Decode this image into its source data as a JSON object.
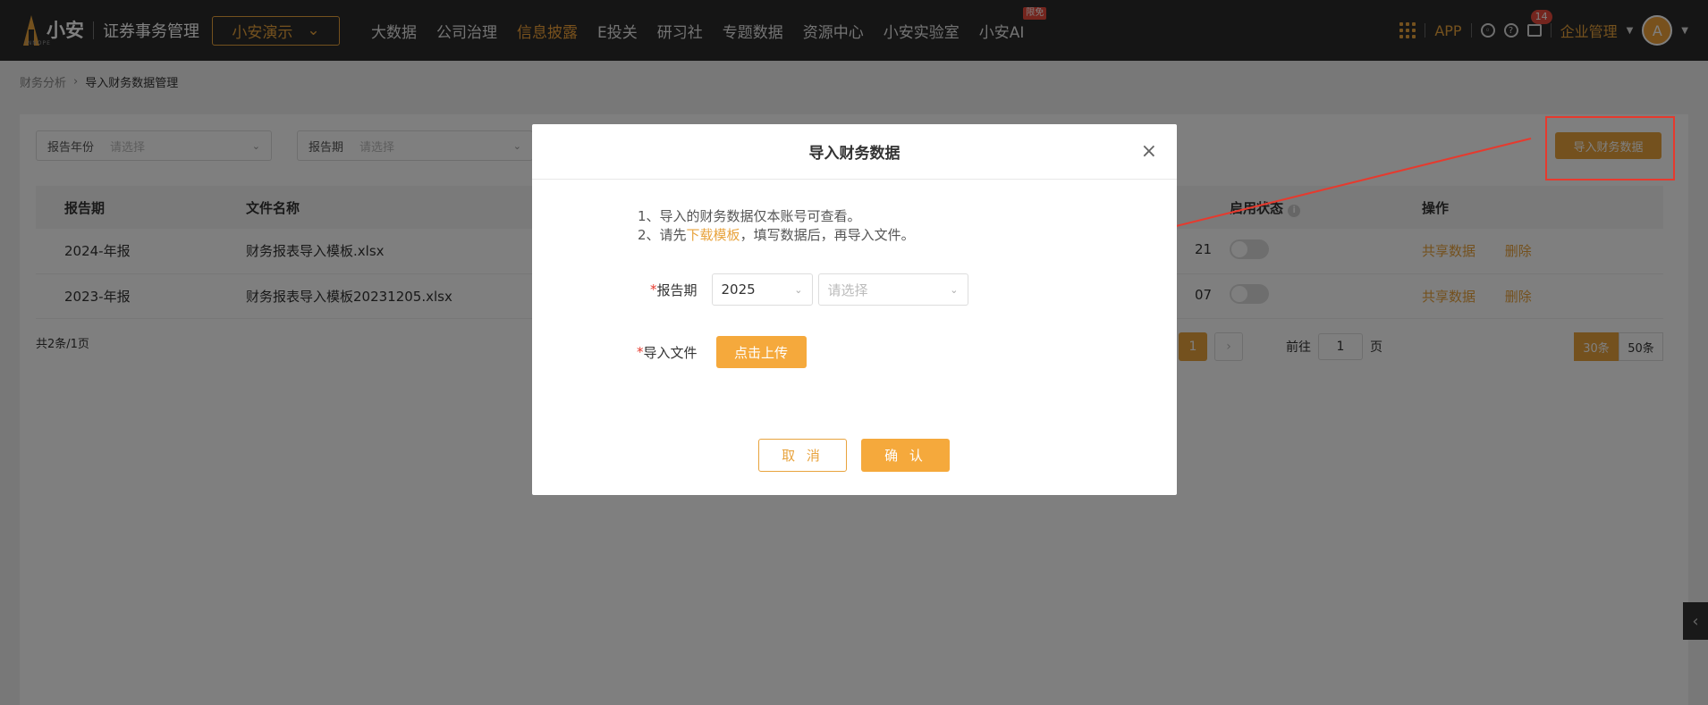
{
  "header": {
    "logo_text": "小安",
    "logo_sub": "INNOPE",
    "app_title": "证券事务管理",
    "company": "小安演示",
    "nav": [
      {
        "label": "大数据"
      },
      {
        "label": "公司治理"
      },
      {
        "label": "信息披露"
      },
      {
        "label": "E投关"
      },
      {
        "label": "研习社"
      },
      {
        "label": "专题数据"
      },
      {
        "label": "资源中心"
      },
      {
        "label": "小安实验室"
      },
      {
        "label": "小安AI"
      }
    ],
    "nav_badge": "限免",
    "app_label": "APP",
    "message_count": "14",
    "enterprise_menu": "企业管理",
    "avatar_letter": "A"
  },
  "breadcrumb": {
    "parent": "财务分析",
    "current": "导入财务数据管理"
  },
  "filters": {
    "year_label": "报告年份",
    "year_placeholder": "请选择",
    "period_label": "报告期",
    "period_placeholder": "请选择"
  },
  "import_button": "导入财务数据",
  "table": {
    "headers": [
      "报告期",
      "文件名称",
      "启用状态",
      "操作"
    ],
    "rows": [
      {
        "period": "2024-年报",
        "file": "财务报表导入模板.xlsx",
        "partial": "21",
        "share": "共享数据",
        "delete": "删除"
      },
      {
        "period": "2023-年报",
        "file": "财务报表导入模板20231205.xlsx",
        "partial": "07",
        "share": "共享数据",
        "delete": "删除"
      }
    ]
  },
  "pagination": {
    "total": "共2条/1页",
    "current_page": "1",
    "goto_label": "前往",
    "goto_value": "1",
    "page_unit": "页",
    "sizes": [
      "30条",
      "50条"
    ]
  },
  "modal": {
    "title": "导入财务数据",
    "note1": "1、导入的财务数据仅本账号可查看。",
    "note2_prefix": "2、请先",
    "note2_link": "下载模板",
    "note2_suffix": "，填写数据后，再导入文件。",
    "period_label": "报告期",
    "year_value": "2025",
    "period_placeholder": "请选择",
    "file_label": "导入文件",
    "upload_button": "点击上传",
    "cancel": "取 消",
    "confirm": "确 认"
  },
  "colors": {
    "accent": "#e8a33d",
    "annotation_red": "#e63a2e"
  }
}
